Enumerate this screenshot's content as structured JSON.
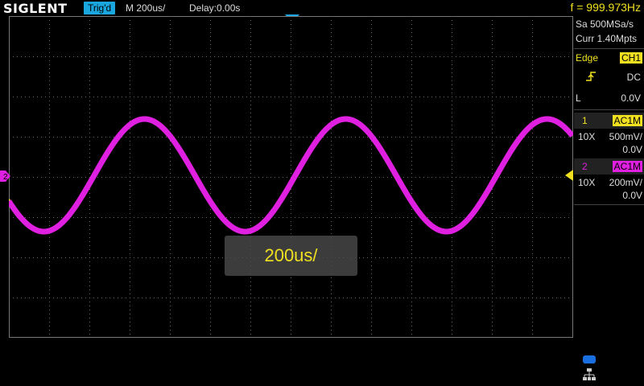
{
  "topbar": {
    "logo": "SIGLENT",
    "trigger_status": "Trig'd",
    "timebase": "M 200us/",
    "delay": "Delay:0.00s",
    "frequency": "f = 999.973Hz"
  },
  "acquisition": {
    "sample_rate": "Sa 500MSa/s",
    "memory_depth": "Curr 1.40Mpts"
  },
  "trigger": {
    "type": "Edge",
    "source": "CH1",
    "coupling": "DC",
    "level_prefix": "L",
    "level": "0.0V",
    "slope_icon": "rising-edge-icon"
  },
  "channels": [
    {
      "number": "1",
      "coupling": "AC1M",
      "probe": "10X",
      "scale": "500mV/",
      "offset": "0.0V",
      "color": "#f0e020"
    },
    {
      "number": "2",
      "coupling": "AC1M",
      "probe": "10X",
      "scale": "200mV/",
      "offset": "0.0V",
      "color": "#e020e0"
    }
  ],
  "popup": {
    "text": "200us/"
  },
  "ch2_marker_label": "2",
  "colors": {
    "ch1": "#f0e020",
    "ch2": "#e020e0",
    "accent": "#1aa7e0",
    "grid": "#6a6a6a"
  }
}
